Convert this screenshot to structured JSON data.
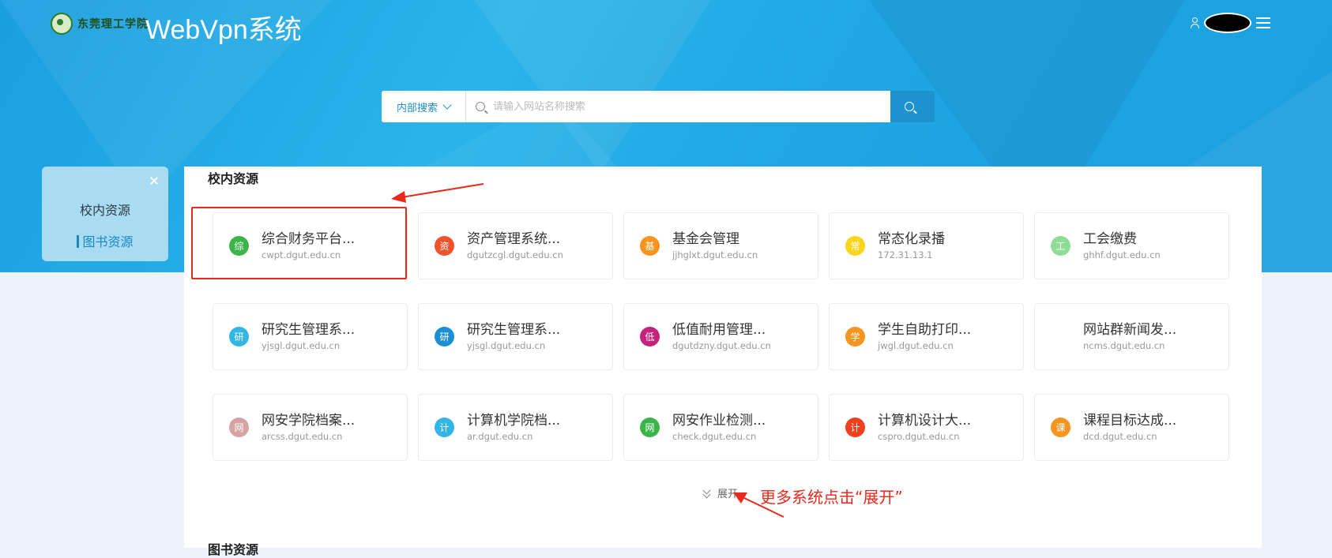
{
  "header": {
    "logo_text": "东莞理工学院",
    "app_title": "WebVpn系统"
  },
  "search": {
    "scope_label": "内部搜索",
    "placeholder": "请输入网站名称搜索",
    "value": ""
  },
  "sidebar": {
    "items": [
      {
        "label": "校内资源"
      },
      {
        "label": "图书资源"
      }
    ]
  },
  "main": {
    "section_title": "校内资源",
    "section2_title": "图书资源",
    "expand_label": "展开",
    "resources": [
      {
        "badge": "综",
        "name": "综合财务平台...",
        "url": "cwpt.dgut.edu.cn",
        "color": "#3bb54a"
      },
      {
        "badge": "资",
        "name": "资产管理系统...",
        "url": "dgutzcgl.dgut.edu.cn",
        "color": "#f0532b"
      },
      {
        "badge": "基",
        "name": "基金会管理",
        "url": "jjhglxt.dgut.edu.cn",
        "color": "#f7941d"
      },
      {
        "badge": "常",
        "name": "常态化录播",
        "url": "172.31.13.1",
        "color": "#f9d51c"
      },
      {
        "badge": "工",
        "name": "工会缴费",
        "url": "ghhf.dgut.edu.cn",
        "color": "#8fdc97"
      },
      {
        "badge": "研",
        "name": "研究生管理系...",
        "url": "yjsgl.dgut.edu.cn",
        "color": "#33b5e5"
      },
      {
        "badge": "研",
        "name": "研究生管理系...",
        "url": "yjsgl.dgut.edu.cn",
        "color": "#1a8fd6"
      },
      {
        "badge": "低",
        "name": "低值耐用管理...",
        "url": "dgutdzny.dgut.edu.cn",
        "color": "#c1247a"
      },
      {
        "badge": "学",
        "name": "学生自助打印...",
        "url": "jwgl.dgut.edu.cn",
        "color": "#f7941d"
      },
      {
        "badge": "",
        "name": "网站群新闻发...",
        "url": "ncms.dgut.edu.cn",
        "color": ""
      },
      {
        "badge": "网",
        "name": "网安学院档案...",
        "url": "arcss.dgut.edu.cn",
        "color": "#d6a3a3"
      },
      {
        "badge": "计",
        "name": "计算机学院档...",
        "url": "ar.dgut.edu.cn",
        "color": "#33b5e5"
      },
      {
        "badge": "网",
        "name": "网安作业检测...",
        "url": "check.dgut.edu.cn",
        "color": "#3bb54a"
      },
      {
        "badge": "计",
        "name": "计算机设计大...",
        "url": "cspro.dgut.edu.cn",
        "color": "#f0411f"
      },
      {
        "badge": "课",
        "name": "课程目标达成...",
        "url": "dcd.dgut.edu.cn",
        "color": "#f7941d"
      }
    ]
  },
  "annotation": {
    "note": "更多系统点击“展开”",
    "color": "#e8291c"
  }
}
